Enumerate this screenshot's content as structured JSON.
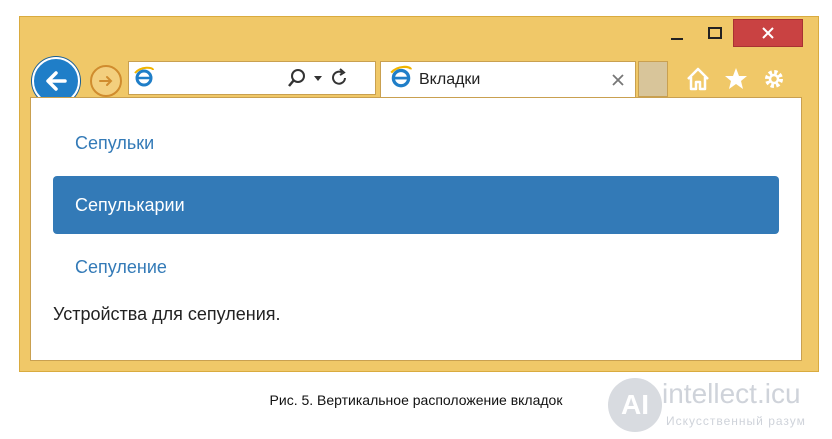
{
  "browser": {
    "tab_title": "Вкладки",
    "address_value": "",
    "colors": {
      "frame": "#f0c868",
      "back": "#1f7ec8",
      "close": "#c94242"
    },
    "icons": [
      "back-icon",
      "forward-icon",
      "ie-icon",
      "search-icon",
      "dropdown-icon",
      "refresh-icon",
      "tab-close-icon",
      "home-icon",
      "favorites-icon",
      "settings-icon"
    ]
  },
  "page": {
    "tabs": [
      {
        "label": "Сепульки",
        "active": false
      },
      {
        "label": "Сепулькарии",
        "active": true
      },
      {
        "label": "Сепуление",
        "active": false
      }
    ],
    "pane_text": "Устройства для сепуления.",
    "accent": "#337ab7"
  },
  "caption": "Рис. 5. Вертикальное расположение вкладок",
  "watermark": {
    "logo": "AI",
    "title": "intellect.icu",
    "subtitle": "Искусственный разум"
  }
}
